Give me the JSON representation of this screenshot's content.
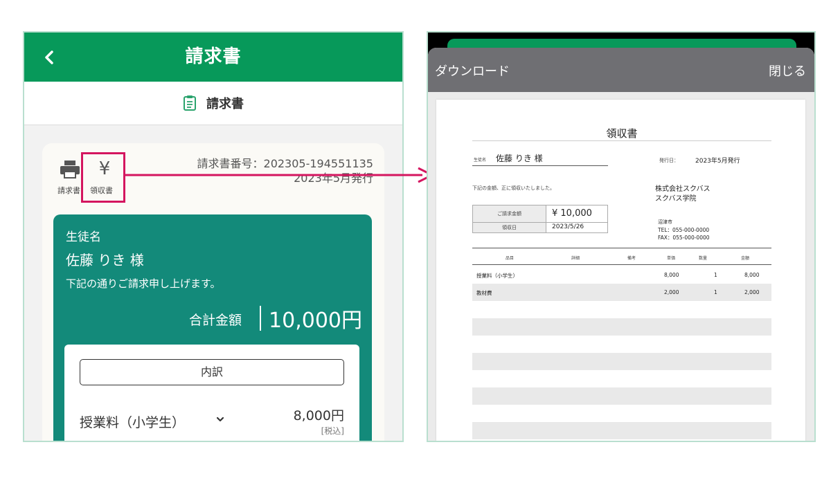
{
  "left_screen": {
    "header_title": "請求書",
    "subheader_label": "請求書",
    "actions": {
      "print_label": "請求書",
      "receipt_label": "領収書",
      "receipt_symbol": "¥"
    },
    "invoice_number": "請求書番号：202305-194551135",
    "issue_date": "2023年5月発行",
    "student_label": "生徒名",
    "student_name": "佐藤 りき 様",
    "greeting": "下記の通りご請求申し上げます。",
    "total_label": "合計金額",
    "total_amount": "10,000円",
    "breakdown_button": "内訳",
    "item": {
      "name": "授業料（小学生）",
      "price": "8,000円",
      "tax_note": "[税込]"
    },
    "colors": {
      "header_green": "#07995a",
      "panel_teal": "#138a7a",
      "highlight_magenta": "#d4155f"
    }
  },
  "right_screen": {
    "modal_download": "ダウンロード",
    "modal_close": "閉じる",
    "receipt": {
      "title": "領収書",
      "student_label": "生徒名",
      "student_name": "佐藤 りき 様",
      "issue_label": "発行日：",
      "issue_value": "2023年5月発行",
      "note": "下記の金額、正に領収いたしました。",
      "company": "株式会社スクバス",
      "school": "スクバス学院",
      "city": "沼津市",
      "tel": "TEL：055-000-0000",
      "fax": "FAX：055-000-0000",
      "amount_label": "ご請求金額",
      "amount_value": "¥ 10,000",
      "received_label": "領収日",
      "received_value": "2023/5/26",
      "table_headers": [
        "品目",
        "詳細",
        "備考",
        "単価",
        "数量",
        "金額"
      ],
      "rows": [
        {
          "item": "授業料（小学生）",
          "unit": "8,000",
          "qty": "1",
          "amount": "8,000"
        },
        {
          "item": "教材費",
          "unit": "2,000",
          "qty": "1",
          "amount": "2,000"
        }
      ]
    }
  }
}
